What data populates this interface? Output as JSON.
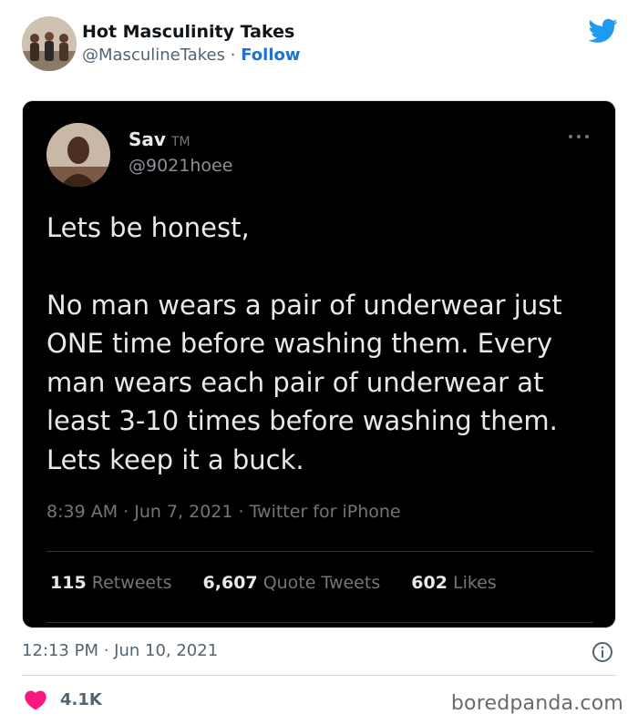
{
  "embed_author": {
    "name": "Hot Masculinity Takes",
    "handle": "@MasculineTakes",
    "separator": "·",
    "follow_label": "Follow"
  },
  "quoted_tweet": {
    "name": "Sav",
    "badge": "TM",
    "handle": "@9021hoee",
    "paragraph_1": "Lets be honest,",
    "paragraph_2": "No man wears a pair of underwear just ONE time before washing them. Every man wears each pair of underwear at least 3-10 times before washing them. Lets keep it a buck.",
    "meta": "8:39 AM · Jun 7, 2021 · Twitter for iPhone",
    "retweets_count": "115",
    "retweets_label": "Retweets",
    "quotes_count": "6,607",
    "quotes_label": "Quote Tweets",
    "likes_count": "602",
    "likes_label": "Likes"
  },
  "footer": {
    "timestamp": "12:13 PM · Jun 10, 2021",
    "like_count": "4.1K"
  },
  "watermark": "boredpanda.com",
  "colors": {
    "follow": "#1d72d8",
    "twitter_blue": "#1d9bf0",
    "heart": "#f91880",
    "dark_bg": "#000000",
    "dark_text": "#e7e9ea",
    "muted": "#536471"
  },
  "icons": [
    "twitter-bird-icon",
    "more-options-icon",
    "info-icon",
    "heart-icon"
  ]
}
